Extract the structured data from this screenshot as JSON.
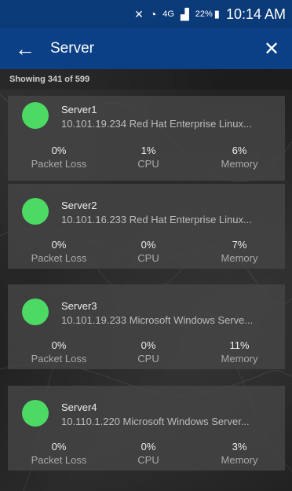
{
  "status_bar": {
    "icons": [
      "mute-icon",
      "wifi-icon",
      "4g-lte-icon",
      "signal-icon"
    ],
    "battery": "22%",
    "time": "10:14 AM"
  },
  "app_bar": {
    "title": "Server",
    "back_icon": "arrow-left-icon",
    "close_icon": "close-icon"
  },
  "showing_text": "Showing 341 of 599",
  "colors": {
    "appbar_bg": "#0b3f86",
    "status_ok": "#4cd964"
  },
  "servers": [
    {
      "name": "Server1",
      "meta": "10.101.19.234  Red Hat Enterprise Linux...",
      "packet_loss": "0%",
      "cpu": "1%",
      "memory": "6%"
    },
    {
      "name": "Server2",
      "meta": "10.101.16.233  Red Hat Enterprise Linux...",
      "packet_loss": "0%",
      "cpu": "0%",
      "memory": "7%"
    },
    {
      "name": "Server3",
      "meta": "10.101.19.233  Microsoft Windows Serve...",
      "packet_loss": "0%",
      "cpu": "0%",
      "memory": "11%"
    },
    {
      "name": "Server4",
      "meta": "10.110.1.220  Microsoft Windows Server...",
      "packet_loss": "0%",
      "cpu": "0%",
      "memory": "3%"
    }
  ],
  "labels": {
    "packet_loss": "Packet Loss",
    "cpu": "CPU",
    "memory": "Memory"
  }
}
